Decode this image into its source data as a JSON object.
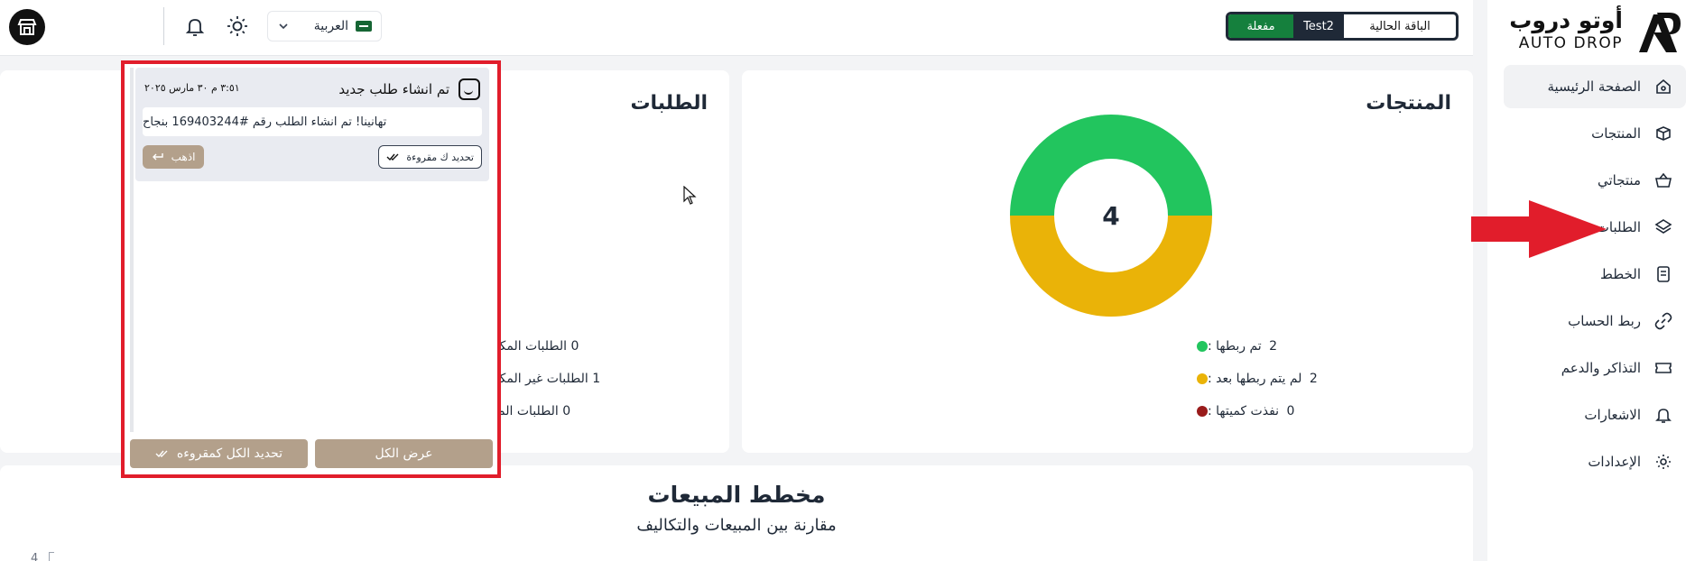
{
  "brand": {
    "name_ar": "أوتو دروب",
    "name_en": "AUTO DROP"
  },
  "sidebar": {
    "items": [
      {
        "label": "الصفحة الرئيسية",
        "icon": "home-icon",
        "active": true
      },
      {
        "label": "المنتجات",
        "icon": "box-icon",
        "active": false
      },
      {
        "label": "منتجاتي",
        "icon": "basket-icon",
        "active": false
      },
      {
        "label": "الطلبات",
        "icon": "layers-icon",
        "active": false
      },
      {
        "label": "الخطط",
        "icon": "plan-icon",
        "active": false
      },
      {
        "label": "ربط الحساب",
        "icon": "link-icon",
        "active": false
      },
      {
        "label": "التذاكر والدعم",
        "icon": "ticket-icon",
        "active": false
      },
      {
        "label": "الاشعارات",
        "icon": "bell-icon",
        "active": false
      },
      {
        "label": "الإعدادات",
        "icon": "gear-icon",
        "active": false
      }
    ]
  },
  "header": {
    "plan_label": "الباقة الحالية",
    "plan_name": "Test2",
    "plan_status": "مفعلة",
    "language": "العربية"
  },
  "products_card": {
    "title": "المنتجات",
    "total": "4",
    "legend": [
      {
        "label": "تم ربطها :",
        "value": "2",
        "color": "#22c55e"
      },
      {
        "label": "لم يتم ربطها بعد :",
        "value": "2",
        "color": "#eab308"
      },
      {
        "label": "نفذت كميتها :",
        "value": "0",
        "color": "#991b1b"
      }
    ],
    "donut": {
      "linked": 2,
      "not_linked": 2,
      "out_of_stock": 0
    }
  },
  "orders_card": {
    "title": "الطلبات",
    "legend": [
      {
        "label": "الطلبات المكتملة :",
        "value": "0",
        "color": "#22c55e"
      },
      {
        "label": "الطلبات غير المكتملة :",
        "value": "1",
        "color": "#eab308"
      },
      {
        "label": "الطلبات الملغاه :",
        "value": "0",
        "color": "#991b1b"
      }
    ]
  },
  "notifications": {
    "items": [
      {
        "title": "تم انشاء طلب جديد",
        "time": "٣:٥١ م ٣٠ مارس ٢٠٢٥",
        "message": "تهانينا! تم انشاء الطلب رقم #169403244 بنجاح",
        "mark_read": "تحديد ك مقروءة",
        "go": "اذهب"
      }
    ],
    "view_all": "عرض الكل",
    "mark_all_read": "تحديد الكل كمقروءه"
  },
  "sales_card": {
    "title": "مخطط المبيعات",
    "subtitle": "مقارنة بين المبيعات والتكاليف",
    "axis_tick": "4"
  },
  "colors": {
    "accent_tan": "#b3a08b",
    "green": "#22c55e",
    "yellow": "#eab308",
    "dark_red": "#991b1b",
    "highlight_red": "#e11d2b"
  }
}
